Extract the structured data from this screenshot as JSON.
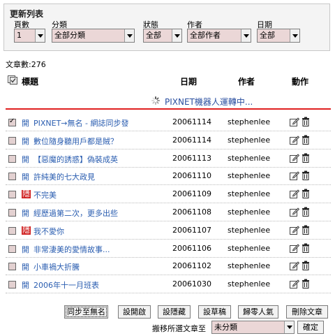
{
  "filters": {
    "title": "更新列表",
    "page": {
      "label": "頁數",
      "value": "1"
    },
    "category": {
      "label": "分類",
      "value": "全部分類"
    },
    "status": {
      "label": "狀態",
      "value": "全部"
    },
    "author": {
      "label": "作者",
      "value": "全部作者"
    },
    "date": {
      "label": "日期",
      "value": "全部"
    }
  },
  "article_count": "文章數:276",
  "table": {
    "headers": {
      "title": "標題",
      "date": "日期",
      "author": "作者",
      "action": "動作"
    },
    "robot_status": "PIXNET機器人運轉中...",
    "rows": [
      {
        "checked": true,
        "status": "開",
        "status_type": "open",
        "title": "PIXNET→無名 - 網誌同步發",
        "date": "20061114",
        "author": "stephenlee"
      },
      {
        "checked": false,
        "status": "開",
        "status_type": "open",
        "title": "數位隨身聽用戶都是賊？",
        "date": "20061114",
        "author": "stephenlee"
      },
      {
        "checked": false,
        "status": "開",
        "status_type": "open",
        "title": "【惡魔的誘惑】偽裝成英",
        "date": "20061113",
        "author": "stephenlee"
      },
      {
        "checked": false,
        "status": "開",
        "status_type": "open",
        "title": "許純美的七大政見",
        "date": "20061110",
        "author": "stephenlee"
      },
      {
        "checked": false,
        "status": "隱",
        "status_type": "hidden",
        "title": "不完美",
        "date": "20061109",
        "author": "stephenlee"
      },
      {
        "checked": false,
        "status": "開",
        "status_type": "open",
        "title": "經歷過第二次，更多出些",
        "date": "20061108",
        "author": "stephenlee"
      },
      {
        "checked": false,
        "status": "隱",
        "status_type": "hidden",
        "title": "我不愛你",
        "date": "20061107",
        "author": "stephenlee"
      },
      {
        "checked": false,
        "status": "開",
        "status_type": "open",
        "title": "非常淒美的愛情故事...",
        "date": "20061106",
        "author": "stephenlee"
      },
      {
        "checked": false,
        "status": "開",
        "status_type": "open",
        "title": "小車禍大折騰",
        "date": "20061102",
        "author": "stephenlee"
      },
      {
        "checked": false,
        "status": "開",
        "status_type": "open",
        "title": "2006年十一月班表",
        "date": "20061030",
        "author": "stephenlee"
      }
    ]
  },
  "actions": {
    "sync_anonymous": "同步至無名",
    "set_public": "設開啟",
    "set_hidden": "設隱藏",
    "set_draft": "設草稿",
    "reset_popularity": "歸零人氣",
    "delete_article": "刪除文章",
    "move_label": "搬移所選文章至",
    "move_target": "未分類",
    "confirm": "確定"
  },
  "colors": {
    "link": "#2a5db0",
    "hidden_badge": "#d02020",
    "divider": "#e02020",
    "select_bg": "#ebd7d7"
  }
}
